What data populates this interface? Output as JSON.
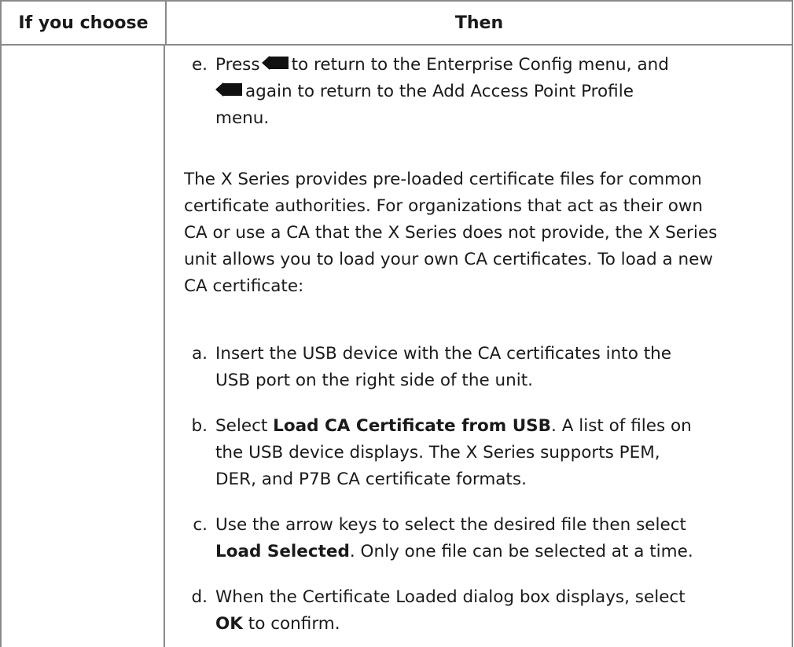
{
  "table": {
    "header": {
      "col1": "If you choose",
      "col2": "Then"
    }
  },
  "step_e": {
    "letter": "e.",
    "part1": "Press",
    "part2": "to return to the Enterprise Config menu, and",
    "part3": "again to return to the Add Access Point Profile",
    "part4": "menu.",
    "icon": "back-arrow-key-icon"
  },
  "intro": {
    "line1": "The X Series provides pre-loaded certificate files for common",
    "line2": "certificate authorities. For organizations that act as their own",
    "line3": "CA or use a CA that the X Series does not provide, the X Series",
    "line4": "unit allows you to load your own CA certificates. To load a new",
    "line5": "CA certificate:"
  },
  "steps": {
    "a": {
      "letter": "a.",
      "line1": "Insert the USB device with the CA certificates into the",
      "line2": "USB port on the right side of the unit."
    },
    "b": {
      "letter": "b.",
      "pre": "Select",
      "bold": "Load CA Certificate from USB",
      "post": ". A list of files on",
      "line2": "the USB device displays. The X Series supports PEM,",
      "line3": "DER, and P7B CA certificate formats."
    },
    "c": {
      "letter": "c.",
      "line1": "Use the arrow keys to select the desired file then select",
      "bold": "Load Selected",
      "post": ". Only one file can be selected at a time."
    },
    "d": {
      "letter": "d.",
      "line1": "When the Certificate Loaded dialog box displays, select",
      "bold": "OK",
      "post": "to confirm."
    }
  },
  "colors": {
    "border": "#8a8a8a",
    "text": "#1a1a1a",
    "icon": "#111111"
  }
}
